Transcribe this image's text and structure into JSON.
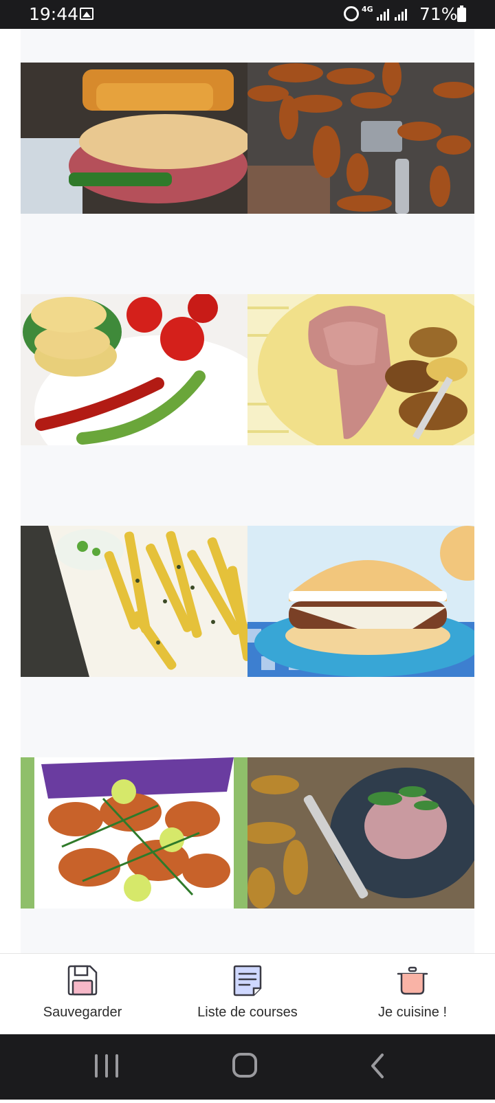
{
  "status_bar": {
    "time": "19:44",
    "network": "4G",
    "battery": "71%"
  },
  "grid": {
    "tiles": [
      {
        "name": "burger-baguette-photo"
      },
      {
        "name": "spiced-potato-wedges-photo"
      },
      {
        "name": "potato-stack-tomatoes-photo"
      },
      {
        "name": "rack-of-lamb-potatoes-photo"
      },
      {
        "name": "herb-fries-dip-photo"
      },
      {
        "name": "cheeseburger-photo"
      },
      {
        "name": "grilled-prawns-photo"
      },
      {
        "name": "tartare-wedges-photo"
      }
    ]
  },
  "actions": {
    "save_label": "Sauvegarder",
    "shopping_list_label": "Liste de courses",
    "cook_label": "Je cuisine !"
  },
  "colors": {
    "icon_outline": "#3a3a44",
    "save_fill": "#f6b8c8",
    "list_fill": "#cfd8ff",
    "pot_fill": "#f9b3a6"
  }
}
